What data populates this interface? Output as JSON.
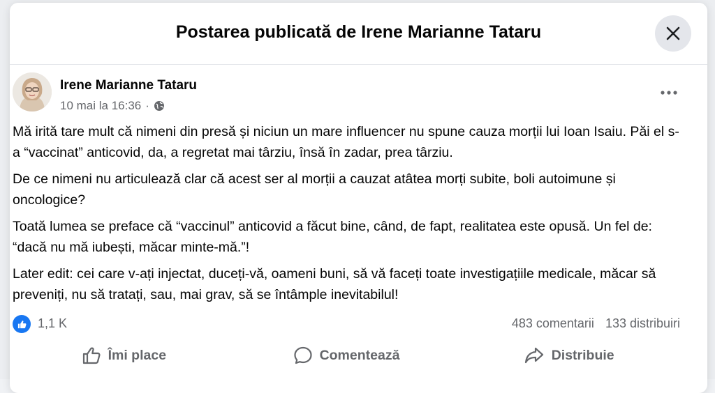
{
  "modal": {
    "title": "Postarea publicată de Irene Marianne Tataru"
  },
  "post": {
    "author": "Irene Marianne Tataru",
    "timestamp": "10 mai la 16:36",
    "separator": "·",
    "audience_icon": "globe-icon",
    "paragraphs": [
      "Mă irită tare mult că nimeni din presă și niciun un mare influencer nu spune cauza morții lui Ioan Isaiu. Păi el s-a “vaccinat” anticovid, da, a regretat mai târziu, însă în zadar, prea târziu.",
      "De ce nimeni nu articulează clar că acest ser al morții a cauzat atâtea morți subite, boli autoimune și oncologice?",
      "Toată lumea se preface că “vaccinul” anticovid a făcut bine, când, de fapt, realitatea este opusă. Un fel de: “dacă nu mă iubești, măcar minte-mă.”!",
      "Later edit: cei care v-ați injectat, duceți-vă, oameni buni, să vă faceți toate investigațiile medicale, măcar să preveniți, nu să tratați, sau, mai grav, să se întâmple inevitabilul!"
    ]
  },
  "stats": {
    "reactions": "1,1 K",
    "comments": "483 comentarii",
    "shares": "133 distribuiri"
  },
  "actions": {
    "like": "Îmi place",
    "comment": "Comentează",
    "share": "Distribuie"
  },
  "colors": {
    "accent": "#1877f2",
    "secondary_text": "#65676b",
    "primary_text": "#050505"
  }
}
